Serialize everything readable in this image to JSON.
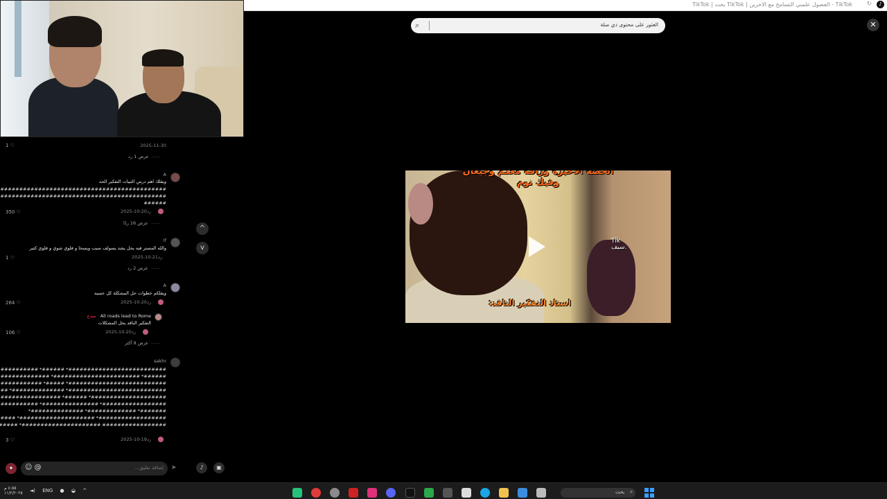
{
  "browser": {
    "title": "TikTok - الفضول علمني التسامح مع الاخرين | TikTok بحث | TikTok",
    "icons": [
      "reload-icon",
      "tiktok-logo-icon"
    ]
  },
  "search": {
    "query": "العثور على محتوى ذي صلة"
  },
  "video": {
    "caption_top_1": "الحصه الاخيرة وزاقه معكم وجيعان",
    "caption_top_2": "وفيك نوم",
    "caption_bottom": "استاذ التفكير الناقد:",
    "watermark_1": "Tik",
    "watermark_2": "سيف."
  },
  "comments": {
    "top_partial": {
      "date": "2025-11-30",
      "likes": "1",
      "view_replies": "عرض 1 رد"
    },
    "items": [
      {
        "user": "A",
        "lines": [
          "ويقلك اهم درس الثبيات التفكير الحد",
          "#################################################",
          "#################################################",
          "######"
        ],
        "date": "2025-10-20",
        "reply": "رد",
        "likes": "350",
        "view_replies": "عرض 16 ردًا"
      },
      {
        "user": "lf",
        "lines": [
          "والله المستر فيه يحل يشد يسولف سبب ويسحا و فلوي شوي و فلوي كتير"
        ],
        "date": "2025-10-21",
        "reply": "رد",
        "likes": "1",
        "view_replies": "عرض 2 رد"
      },
      {
        "user": "A",
        "lines": [
          "ويقلكم خطوات حل المشكلة كل حسبه"
        ],
        "date": "2025-10-20",
        "reply": "رد",
        "likes": "264",
        "sub_reply": {
          "user": "All roads lead to Rome",
          "badge": "· مبدع",
          "text": "التفكير الناقد يحل المشكلات",
          "date": "2025-10-20",
          "reply": "رد",
          "likes": "106"
        },
        "view_replies": "عرض 9 أكثر"
      },
      {
        "user": "sakhr",
        "lines": [
          "##########################* ######* ############* ######*",
          "######* #######################* ######################*",
          "##########################* #####* ###################*",
          "##########################* ##############* ##############*",
          "####################* ######* ########################*",
          "#################* ###############* #####################*",
          "#######* #############* ##############*",
          "##################* ####################* ##############*",
          "################# #####################* ##############*"
        ],
        "date": "2025-10-19",
        "reply": "رد",
        "likes": "3"
      }
    ]
  },
  "input": {
    "placeholder": "إضافة تعليق...",
    "emoji": "☺",
    "mention": "@"
  },
  "controls": {
    "close": "✕",
    "up": "^",
    "down": "v"
  },
  "taskbar": {
    "time": "٤:٥٥ م",
    "date": "١١/٢/٢٠٢٥",
    "lang": "ENG",
    "search_label": "بحث"
  },
  "colors": {
    "caption": "#ff6a1c",
    "background": "#000000",
    "accent": "#fe2c55"
  }
}
